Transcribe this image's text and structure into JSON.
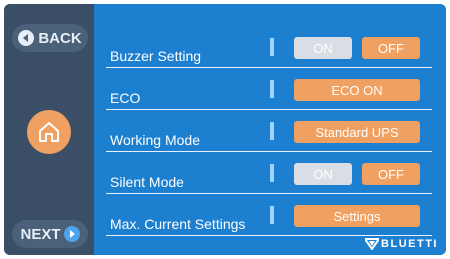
{
  "nav": {
    "back_label": "BACK",
    "next_label": "NEXT"
  },
  "settings": {
    "buzzer": {
      "label": "Buzzer Setting",
      "on_label": "ON",
      "off_label": "OFF",
      "selected": "OFF"
    },
    "eco": {
      "label": "ECO",
      "button_label": "ECO ON"
    },
    "working_mode": {
      "label": "Working Mode",
      "button_label": "Standard UPS"
    },
    "silent_mode": {
      "label": "Silent Mode",
      "on_label": "ON",
      "off_label": "OFF",
      "selected": "OFF"
    },
    "max_current": {
      "label": "Max. Current Settings",
      "button_label": "Settings"
    }
  },
  "brand": {
    "name": "BLUETTI"
  },
  "colors": {
    "sidebar": "#3a4f66",
    "main_background": "#1c7fd0",
    "accent_orange": "#f0a060",
    "inactive_gray": "#d9dee4"
  },
  "icons": {
    "back": "back-arrow-icon",
    "home": "home-icon",
    "next": "next-arrow-icon",
    "logo": "bluetti-logo-icon"
  }
}
